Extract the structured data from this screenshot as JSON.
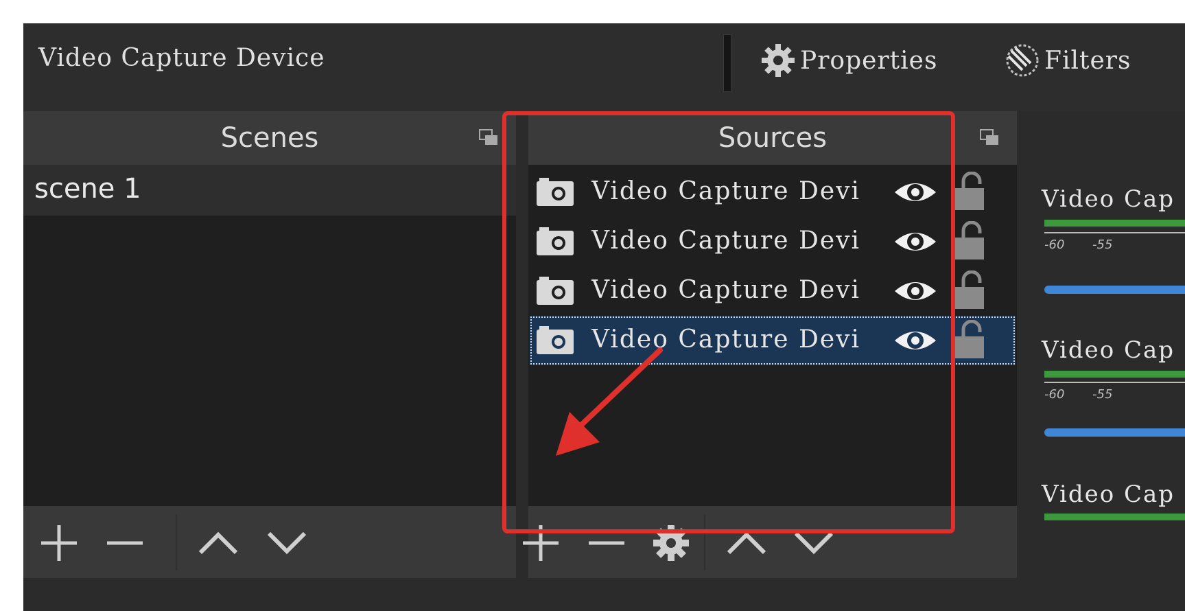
{
  "topbar": {
    "source_title": "Video Capture Device",
    "properties_label": "Properties",
    "filters_label": "Filters"
  },
  "scenes": {
    "title": "Scenes",
    "items": [
      {
        "label": "scene 1"
      }
    ],
    "toolbar": [
      "plus-icon",
      "minus-icon",
      "chevron-up-icon",
      "chevron-down-icon"
    ]
  },
  "sources": {
    "title": "Sources",
    "items": [
      {
        "label": "Video Capture Devi",
        "visible": true,
        "locked": false,
        "selected": false
      },
      {
        "label": "Video Capture Devi",
        "visible": true,
        "locked": false,
        "selected": false
      },
      {
        "label": "Video Capture Devi",
        "visible": true,
        "locked": false,
        "selected": false
      },
      {
        "label": "Video Capture Devi",
        "visible": true,
        "locked": false,
        "selected": true
      }
    ],
    "toolbar": [
      "plus-icon",
      "minus-icon",
      "gear-icon",
      "chevron-up-icon",
      "chevron-down-icon"
    ]
  },
  "mixer": {
    "channels": [
      {
        "label": "Video Cap",
        "ticks": [
          "-60",
          "-55"
        ]
      },
      {
        "label": "Video Cap",
        "ticks": [
          "-60",
          "-55"
        ]
      },
      {
        "label": "Video Cap"
      }
    ]
  },
  "annotation": {
    "highlight_color": "#e0302c"
  },
  "colors": {
    "panel_bg": "#1f1f1f",
    "header_bg": "#3a3a3a",
    "selected_row": "#1b3555",
    "meter_green": "#3c9a3c",
    "fader_blue": "#3f86d6"
  }
}
